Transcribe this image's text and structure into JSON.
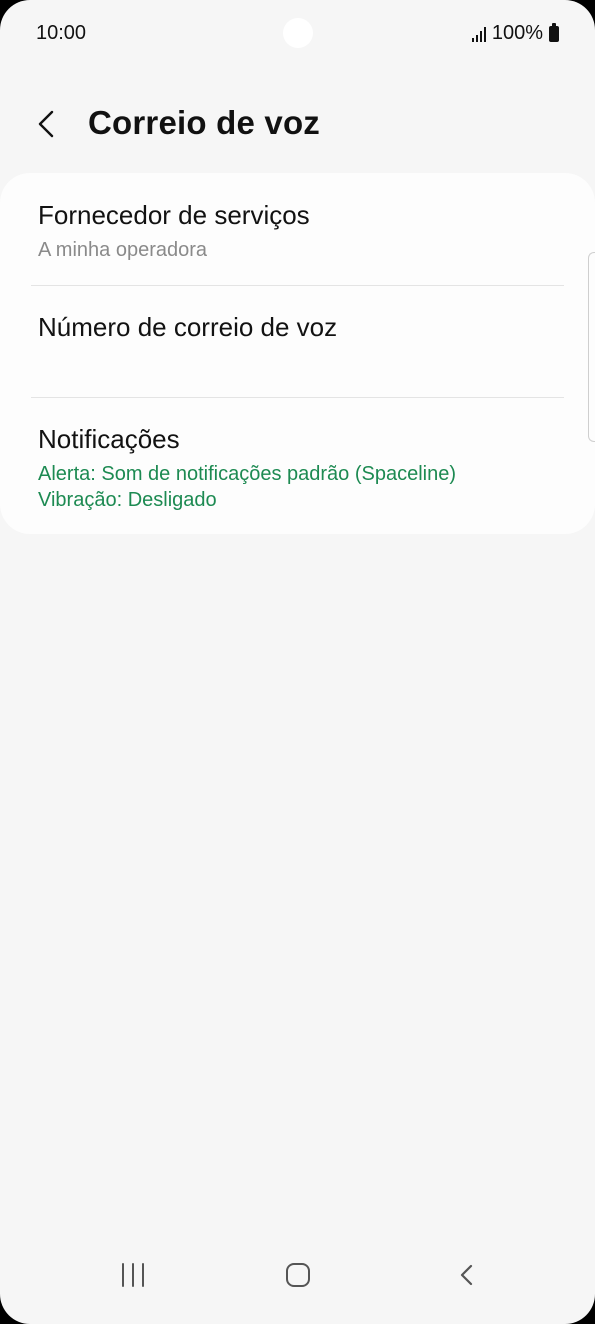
{
  "status_bar": {
    "time": "10:00",
    "battery": "100%",
    "icons": [
      "signal-icon",
      "battery-icon"
    ]
  },
  "header": {
    "title": "Correio de voz",
    "back_icon": "chevron-left-icon"
  },
  "settings": {
    "items": [
      {
        "title": "Fornecedor de serviços",
        "subtitle": "A minha operadora"
      },
      {
        "title": "Número de correio de voz"
      },
      {
        "title": "Notificações",
        "subtitle_lines": [
          "Alerta: Som de notificações padrão (Spaceline)",
          "Vibração: Desligado"
        ]
      }
    ]
  },
  "colors": {
    "background": "#f6f6f6",
    "card": "#fdfdfd",
    "accent_green": "#1d8a52",
    "subtitle_gray": "#8a8a8a"
  },
  "nav_bar": {
    "icons": [
      "recent-apps-icon",
      "home-icon",
      "back-icon"
    ]
  }
}
